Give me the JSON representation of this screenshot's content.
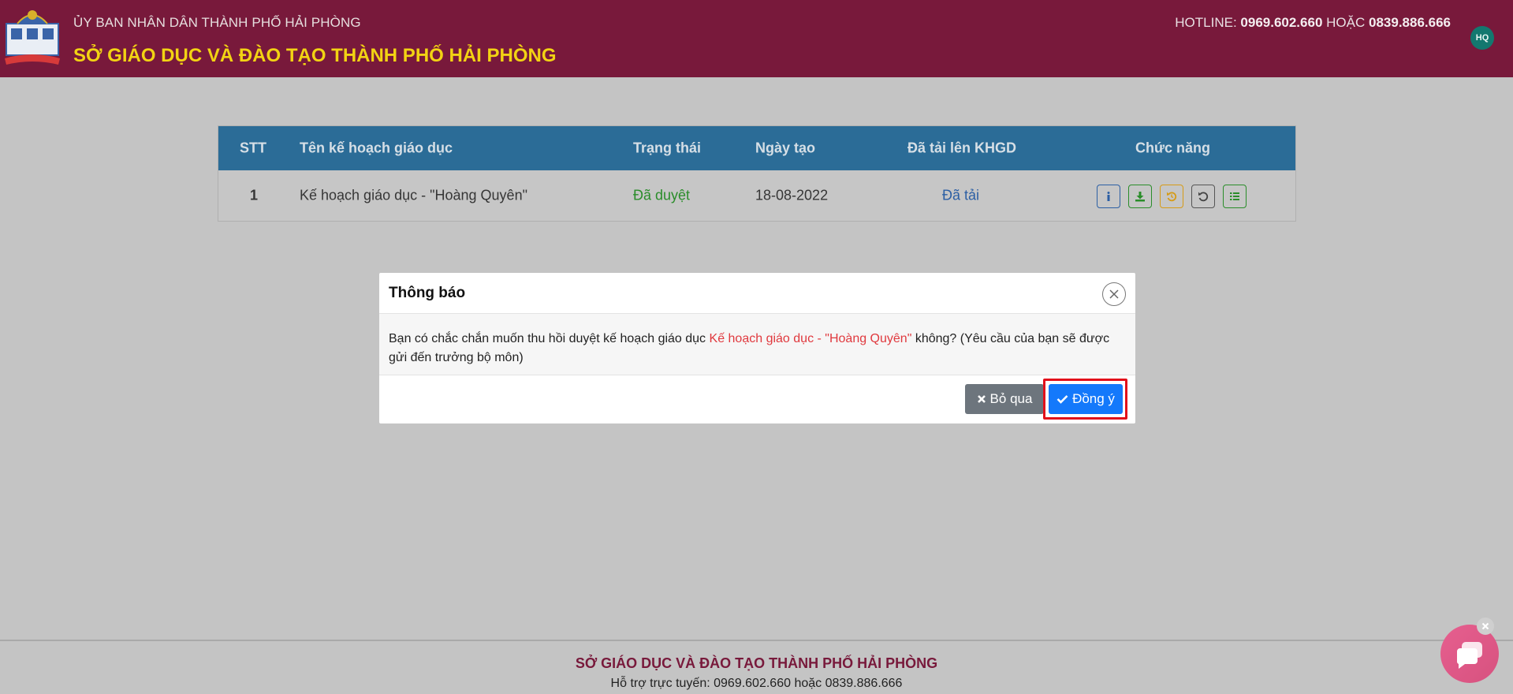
{
  "header": {
    "org_top": "ỦY BAN NHÂN DÂN THÀNH PHỐ HẢI PHÒNG",
    "org_main": "SỞ GIÁO DỤC VÀ ĐÀO TẠO THÀNH PHỐ HẢI PHÒNG",
    "hotline_label": "HOTLINE:",
    "hotline_1": "0969.602.660",
    "hotline_or": "HOẶC",
    "hotline_2": "0839.886.666",
    "avatar_initials": "HQ"
  },
  "table": {
    "columns": [
      "STT",
      "Tên kế hoạch giáo dục",
      "Trạng thái",
      "Ngày tạo",
      "Đã tải lên KHGD",
      "Chức năng"
    ],
    "rows": [
      {
        "stt": "1",
        "name": "Kế hoạch giáo dục - \"Hoàng Quyên\"",
        "status": "Đã duyệt",
        "created": "18-08-2022",
        "uploaded": "Đã tải",
        "actions": [
          "info-icon",
          "download-icon",
          "undo-icon",
          "reset-icon",
          "list-icon"
        ]
      }
    ]
  },
  "modal": {
    "title": "Thông báo",
    "body_prefix": "Bạn có chắc chắn muốn thu hồi duyệt kế hoạch giáo dục",
    "body_highlight": "Kế hoạch giáo dục - \"Hoàng Quyên\"",
    "body_suffix": "không? (Yêu cầu của bạn sẽ được gửi đến trưởng bộ môn)",
    "cancel_label": "Bỏ qua",
    "ok_label": "Đồng ý"
  },
  "footer": {
    "title": "SỞ GIÁO DỤC VÀ ĐÀO TẠO THÀNH PHỐ HẢI PHÒNG",
    "support": "Hỗ trợ trực tuyến: 0969.602.660 hoặc 0839.886.666"
  },
  "colors": {
    "header_bg": "#78193b",
    "title_yellow": "#f2d313",
    "table_head": "#2b6c97",
    "status_green": "#2a8d2a",
    "highlight_red": "#e0393e",
    "ok_blue": "#1479fb",
    "cancel_gray": "#6d757d"
  }
}
